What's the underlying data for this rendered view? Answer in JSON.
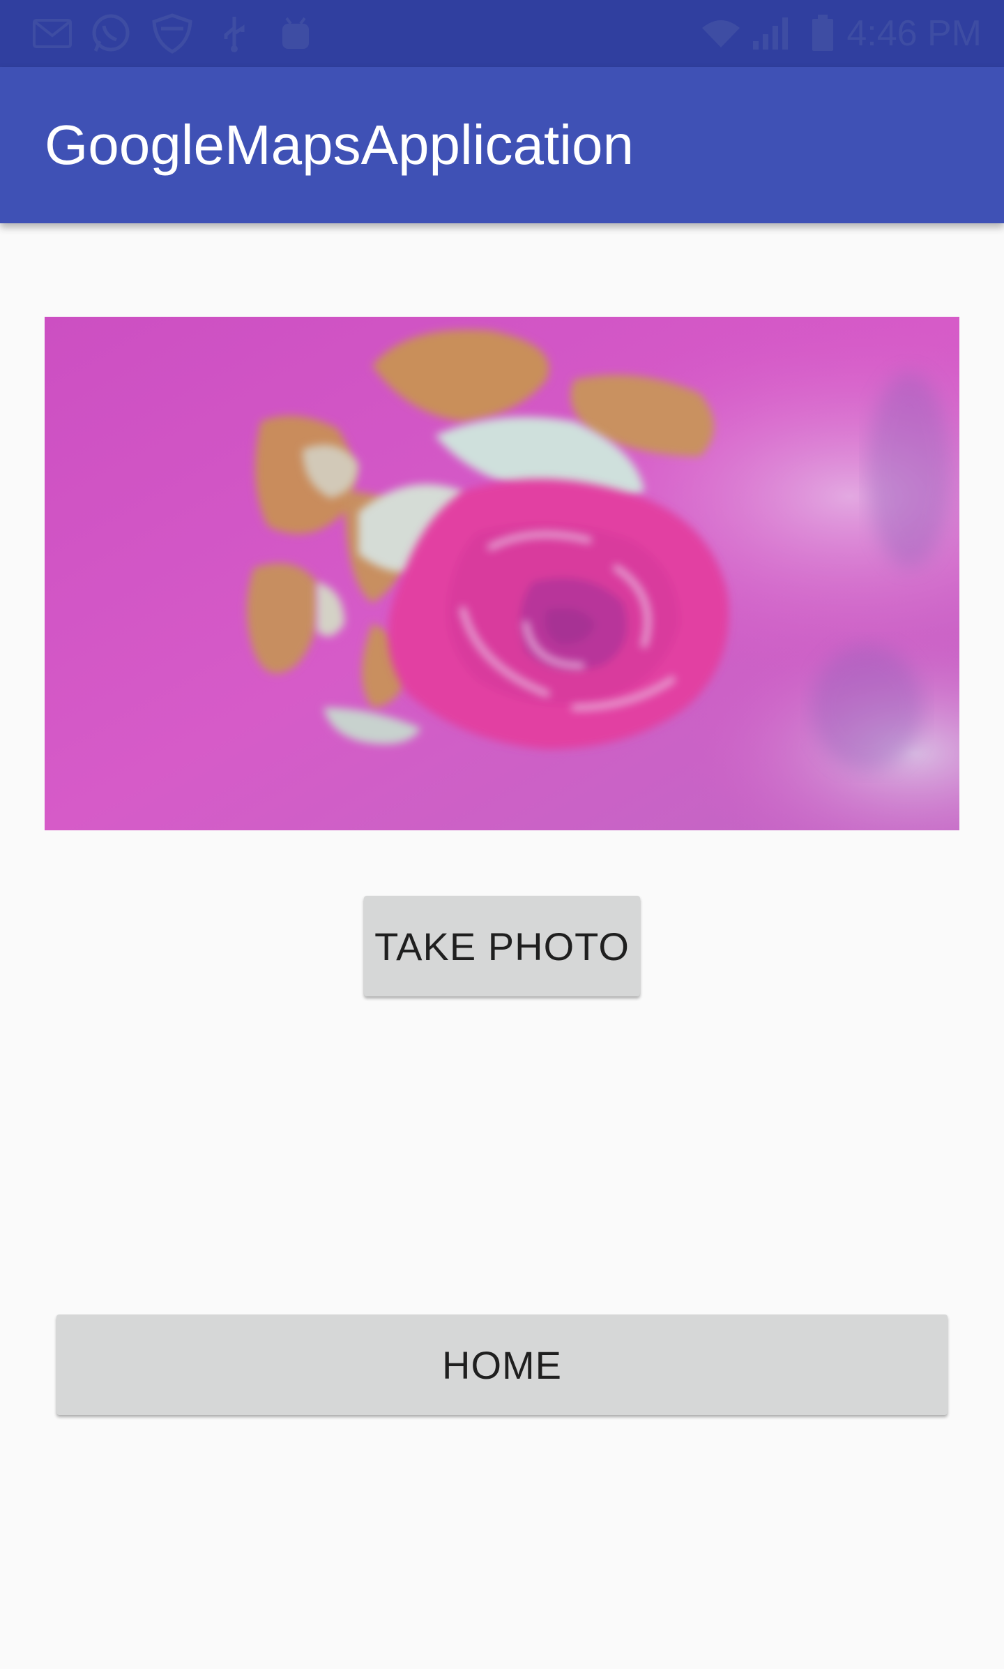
{
  "status_bar": {
    "time": "4:46 PM",
    "left_icons": [
      "gmail-icon",
      "whatsapp-icon",
      "shield-icon",
      "usb-icon",
      "android-debug-icon"
    ],
    "right_icons": [
      "wifi-icon",
      "signal-icon",
      "battery-icon"
    ],
    "background": "#303f9f"
  },
  "app_bar": {
    "title": "GoogleMapsApplication",
    "background": "#3f51b5",
    "title_color": "#ffffff"
  },
  "photo": {
    "subject": "pink rose pattern on fabric",
    "base_color": "#d45ac4"
  },
  "buttons": {
    "take_photo": "TAKE PHOTO",
    "home": "HOME",
    "background": "#d6d7d7",
    "text_color": "#1f1f1f"
  },
  "page_background": "#fafafa"
}
